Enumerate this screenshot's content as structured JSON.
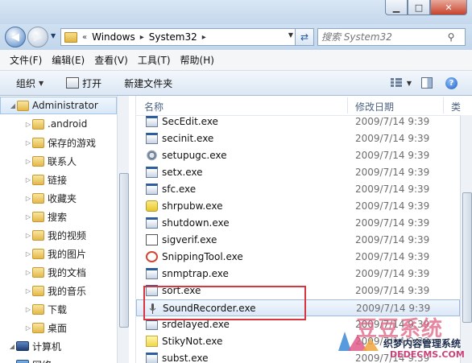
{
  "window": {
    "minimize_glyph": "▁",
    "maximize_glyph": "□",
    "close_glyph": "✕"
  },
  "address": {
    "overflow": "«",
    "crumbs": [
      "Windows",
      "System32"
    ],
    "separator": "▸",
    "search_placeholder": "搜索 System32"
  },
  "menu": [
    "文件(F)",
    "编辑(E)",
    "查看(V)",
    "工具(T)",
    "帮助(H)"
  ],
  "toolbar": {
    "organize": "组织",
    "open": "打开",
    "new_folder": "新建文件夹"
  },
  "nav": {
    "items": [
      {
        "label": "Administrator",
        "icon": "user-folder-icon",
        "selected": true
      },
      {
        "label": ".android",
        "icon": "folder-icon"
      },
      {
        "label": "保存的游戏",
        "icon": "folder-icon"
      },
      {
        "label": "联系人",
        "icon": "folder-icon"
      },
      {
        "label": "链接",
        "icon": "folder-icon"
      },
      {
        "label": "收藏夹",
        "icon": "folder-icon"
      },
      {
        "label": "搜索",
        "icon": "folder-icon"
      },
      {
        "label": "我的视频",
        "icon": "folder-icon"
      },
      {
        "label": "我的图片",
        "icon": "folder-icon"
      },
      {
        "label": "我的文档",
        "icon": "folder-icon"
      },
      {
        "label": "我的音乐",
        "icon": "folder-icon"
      },
      {
        "label": "下载",
        "icon": "folder-icon"
      },
      {
        "label": "桌面",
        "icon": "folder-icon"
      },
      {
        "label": "计算机",
        "icon": "computer-icon"
      },
      {
        "label": "网络",
        "icon": "network-icon"
      }
    ]
  },
  "columns": {
    "name": "名称",
    "date": "修改日期",
    "type": "类"
  },
  "files": [
    {
      "name": "SecEdit.exe",
      "date": "2009/7/14 9:39",
      "icon": "exe"
    },
    {
      "name": "secinit.exe",
      "date": "2009/7/14 9:39",
      "icon": "exe"
    },
    {
      "name": "setupugc.exe",
      "date": "2009/7/14 9:39",
      "icon": "gear"
    },
    {
      "name": "setx.exe",
      "date": "2009/7/14 9:39",
      "icon": "exe"
    },
    {
      "name": "sfc.exe",
      "date": "2009/7/14 9:39",
      "icon": "exe"
    },
    {
      "name": "shrpubw.exe",
      "date": "2009/7/14 9:39",
      "icon": "puzzle"
    },
    {
      "name": "shutdown.exe",
      "date": "2009/7/14 9:39",
      "icon": "exe"
    },
    {
      "name": "sigverif.exe",
      "date": "2009/7/14 9:39",
      "icon": "check"
    },
    {
      "name": "SnippingTool.exe",
      "date": "2009/7/14 9:39",
      "icon": "snip"
    },
    {
      "name": "snmptrap.exe",
      "date": "2009/7/14 9:39",
      "icon": "exe"
    },
    {
      "name": "sort.exe",
      "date": "2009/7/14 9:39",
      "icon": "exe"
    },
    {
      "name": "SoundRecorder.exe",
      "date": "2009/7/14 9:39",
      "icon": "mic",
      "selected": true
    },
    {
      "name": "srdelayed.exe",
      "date": "2009/7/14 9:39",
      "icon": "exe"
    },
    {
      "name": "StikyNot.exe",
      "date": "2009/7/14 9:39",
      "icon": "note"
    },
    {
      "name": "subst.exe",
      "date": "2009/7/14 9:39",
      "icon": "exe"
    }
  ],
  "watermark": {
    "main": "豆豆系统",
    "sub": "织梦内容管理系统",
    "url": "DEDECMS.COM",
    "url2": "xitongcheng.com"
  }
}
